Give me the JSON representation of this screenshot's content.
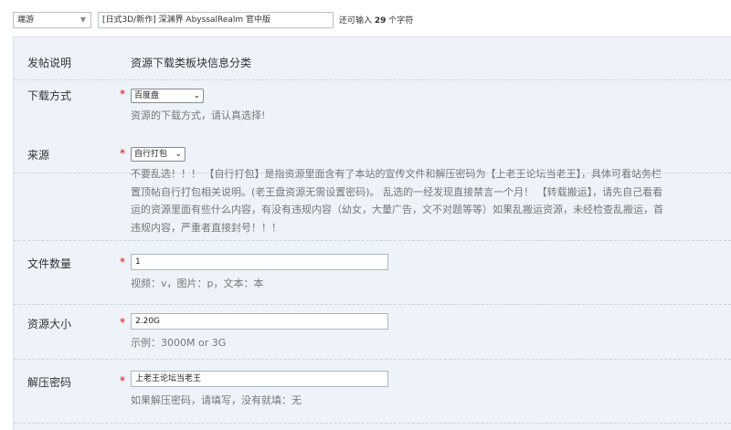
{
  "top": {
    "type_select": "端游",
    "title_value": "[日式3D/新作] 深渊界 AbyssalRealm 官中版",
    "remain_prefix": "还可输入",
    "remain_count": "29",
    "remain_suffix": "个字符"
  },
  "form": {
    "desc": {
      "label": "发帖说明",
      "value": "资源下载类板块信息分类"
    },
    "download": {
      "label": "下载方式",
      "star": "*",
      "selected": "百度盘",
      "hint": "资源的下载方式，请认真选择!"
    },
    "source": {
      "label": "来源",
      "star": "*",
      "selected": "自行打包",
      "hint_lines": [
        "不要乱选！！！ 【自行打包】是指资源里面含有了本站的宣传文件和解压密码为【上老王论坛当老王】，具体可看站务栏",
        "置顶帖自行打包相关说明。(老王盘资源无需设置密码)。 乱选的一经发现直接禁言一个月！ 【转载搬运】，请先自己看看",
        "运的资源里面有些什么内容，有没有违规内容（幼女，大量广告，文不对题等等）如果乱搬运资源，未经检查乱搬运，首",
        "违规内容，严重者直接封号！！！"
      ]
    },
    "file_count": {
      "label": "文件数量",
      "star": "*",
      "value": "1",
      "hint": "视频：v，图片：p，文本：本"
    },
    "size": {
      "label": "资源大小",
      "star": "*",
      "value": "2.20G",
      "hint": "示例：3000M or 3G"
    },
    "password": {
      "label": "解压密码",
      "star": "*",
      "value": "上老王论坛当老王",
      "hint": "如果解压密码，请填写，没有就填：无"
    }
  },
  "icons": {
    "dropdown": "chevron-down-icon"
  }
}
